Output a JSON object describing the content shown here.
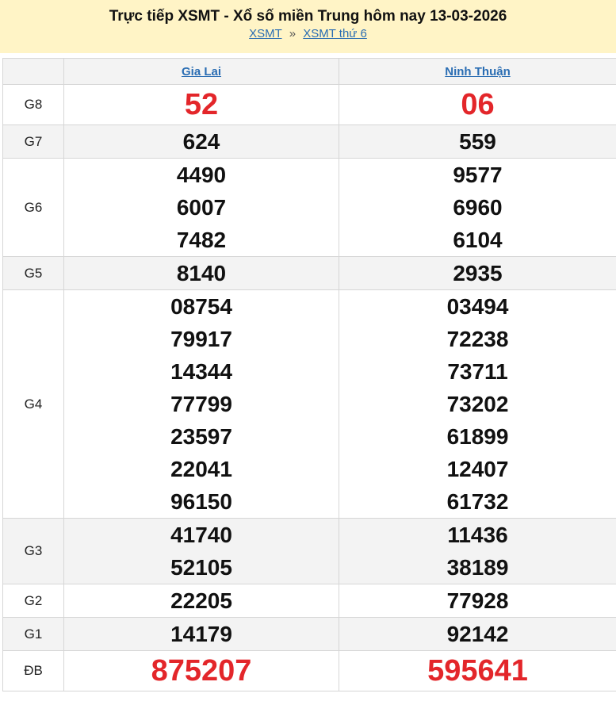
{
  "header": {
    "title": "Trực tiếp XSMT - Xổ số miền Trung hôm nay 13-03-2026",
    "breadcrumb": [
      "XSMT",
      "XSMT thứ 6"
    ],
    "separator": "»"
  },
  "provinces": [
    "Gia Lai",
    "Ninh Thuận"
  ],
  "prizes": [
    {
      "label": "G8",
      "values": [
        [
          "52"
        ],
        [
          "06"
        ]
      ]
    },
    {
      "label": "G7",
      "values": [
        [
          "624"
        ],
        [
          "559"
        ]
      ]
    },
    {
      "label": "G6",
      "values": [
        [
          "4490",
          "6007",
          "7482"
        ],
        [
          "9577",
          "6960",
          "6104"
        ]
      ]
    },
    {
      "label": "G5",
      "values": [
        [
          "8140"
        ],
        [
          "2935"
        ]
      ]
    },
    {
      "label": "G4",
      "values": [
        [
          "08754",
          "79917",
          "14344",
          "77799",
          "23597",
          "22041",
          "96150"
        ],
        [
          "03494",
          "72238",
          "73711",
          "73202",
          "61899",
          "12407",
          "61732"
        ]
      ]
    },
    {
      "label": "G3",
      "values": [
        [
          "41740",
          "52105"
        ],
        [
          "11436",
          "38189"
        ]
      ]
    },
    {
      "label": "G2",
      "values": [
        [
          "22205"
        ],
        [
          "77928"
        ]
      ]
    },
    {
      "label": "G1",
      "values": [
        [
          "14179"
        ],
        [
          "92142"
        ]
      ]
    },
    {
      "label": "ĐB",
      "values": [
        [
          "875207"
        ],
        [
          "595641"
        ]
      ]
    }
  ],
  "colors": {
    "header_bg": "#fff4c6",
    "link": "#2a6db3",
    "highlight": "#e3262a",
    "alt_row": "#f3f3f3"
  }
}
